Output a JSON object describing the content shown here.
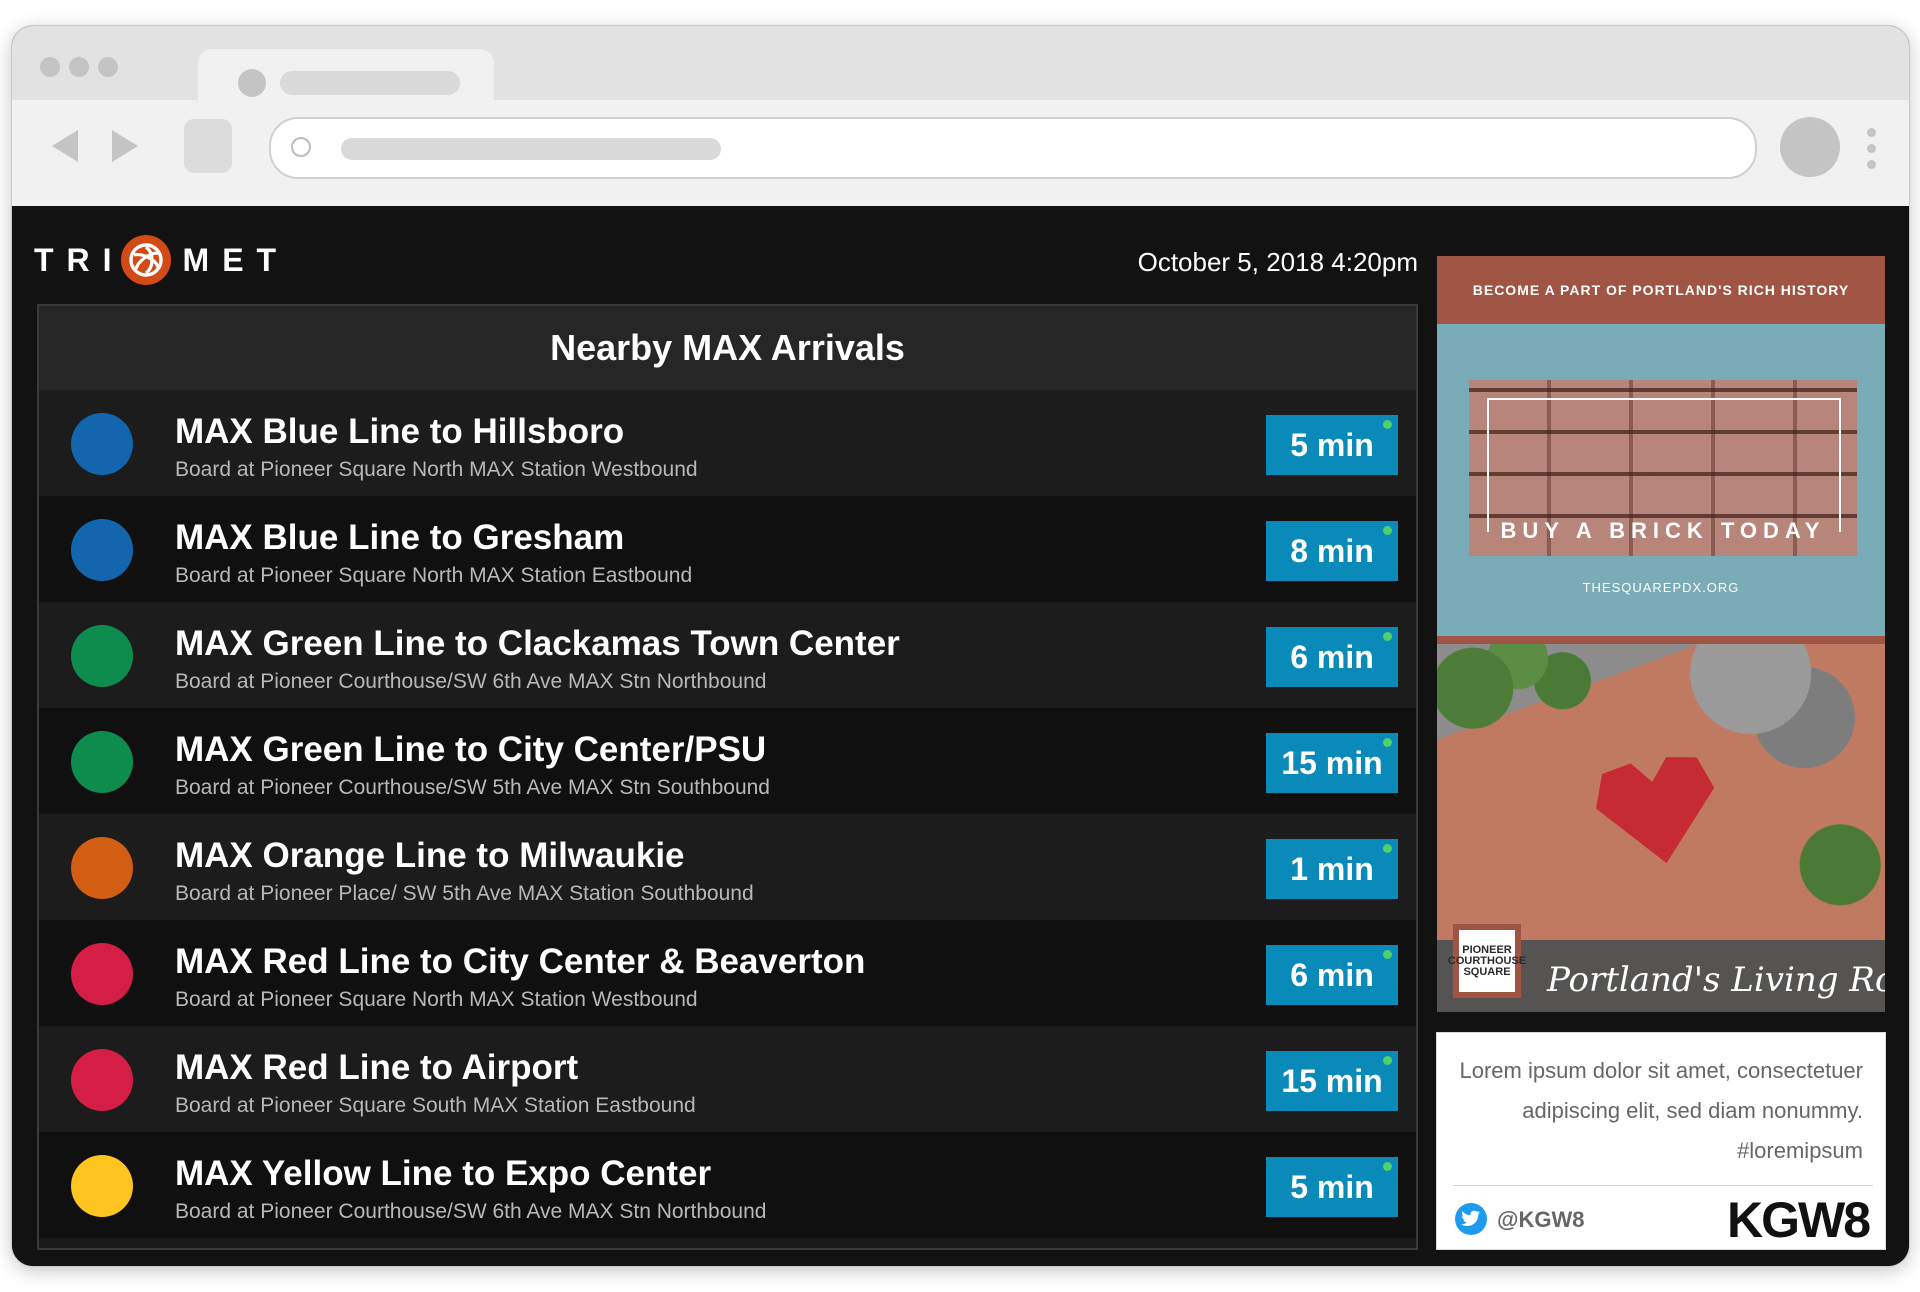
{
  "header": {
    "logo_left": "TRI",
    "logo_right": "MET",
    "datetime": "October 5, 2018 4:20pm"
  },
  "arrivals": {
    "title": "Nearby MAX Arrivals",
    "rows": [
      {
        "line": "MAX Blue Line to Hillsboro",
        "stop": "Board at Pioneer Square North MAX Station Westbound",
        "eta": "5 min",
        "color": "#1366ae"
      },
      {
        "line": "MAX Blue Line to Gresham",
        "stop": "Board at Pioneer Square North MAX Station Eastbound",
        "eta": "8 min",
        "color": "#1366ae"
      },
      {
        "line": "MAX Green Line to Clackamas Town Center",
        "stop": "Board at Pioneer Courthouse/SW 6th Ave MAX Stn Northbound",
        "eta": "6 min",
        "color": "#0d8c4e"
      },
      {
        "line": "MAX Green Line to City Center/PSU",
        "stop": "Board at Pioneer Courthouse/SW 5th Ave MAX Stn Southbound",
        "eta": "15 min",
        "color": "#0d8c4e"
      },
      {
        "line": "MAX Orange Line to Milwaukie",
        "stop": "Board at Pioneer Place/ SW 5th Ave MAX Station Southbound",
        "eta": "1 min",
        "color": "#d25e14"
      },
      {
        "line": "MAX Red Line to City Center & Beaverton",
        "stop": "Board at Pioneer Square North MAX Station Westbound",
        "eta": "6 min",
        "color": "#d51e45"
      },
      {
        "line": "MAX Red Line to Airport",
        "stop": "Board at Pioneer Square South MAX Station Eastbound",
        "eta": "15 min",
        "color": "#d51e45"
      },
      {
        "line": "MAX Yellow Line to Expo Center",
        "stop": "Board at Pioneer Courthouse/SW 6th Ave MAX Stn Northbound",
        "eta": "5 min",
        "color": "#fec521"
      }
    ]
  },
  "ad": {
    "banner": "BECOME A PART OF PORTLAND'S RICH HISTORY",
    "cta": "BUY A BRICK TODAY",
    "url": "THESQUAREPDX.ORG",
    "badge": "PIONEER COURTHOUSE SQUARE",
    "tagline": "Portland's Living Room"
  },
  "social": {
    "text": "Lorem ipsum dolor sit amet, consectetuer adipiscing elit, sed diam nonummy. #loremipsum",
    "handle": "@KGW8",
    "brand": "KGW8"
  },
  "colors": {
    "accent_badge": "#0a8ab8",
    "trimet_orange": "#d24b17",
    "ad_brick": "#a05444",
    "ad_blue": "#7aacb8"
  },
  "icons": [
    "trimet-logo-icon",
    "twitter-icon",
    "live-indicator-icon"
  ]
}
